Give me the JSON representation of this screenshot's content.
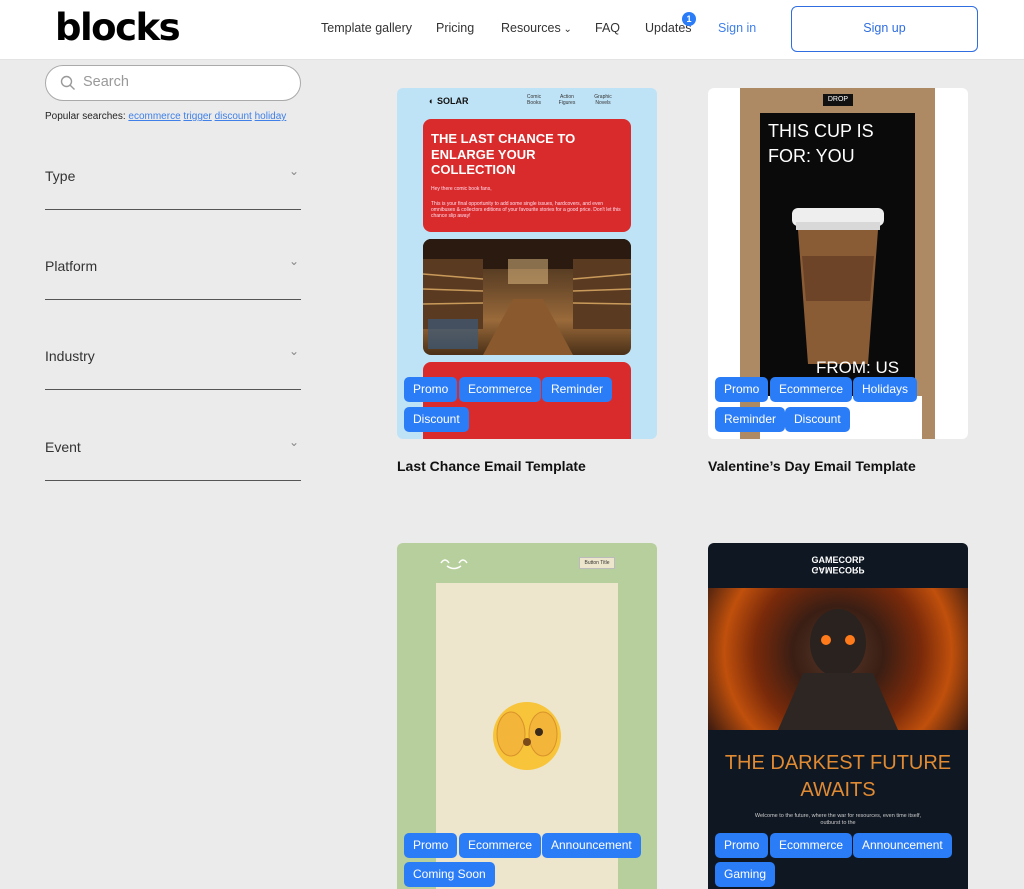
{
  "header": {
    "logo": "blocks",
    "nav": {
      "template_gallery": "Template gallery",
      "pricing": "Pricing",
      "resources": "Resources",
      "faq": "FAQ",
      "updates": "Updates",
      "updates_badge": "1",
      "sign_in": "Sign in",
      "sign_up": "Sign up"
    }
  },
  "sidebar": {
    "search_placeholder": "Search",
    "popular_label": "Popular searches:",
    "popular": [
      "ecommerce",
      "trigger",
      "discount",
      "holiday"
    ],
    "filters": [
      "Type",
      "Platform",
      "Industry",
      "Event"
    ]
  },
  "cards": [
    {
      "title": "Last Chance Email Template",
      "tags": [
        "Promo",
        "Ecommerce",
        "Reminder",
        "Discount"
      ],
      "preview": {
        "brand": "SOLAR",
        "nav": [
          "Comic Books",
          "Action Figures",
          "Graphic Novels"
        ],
        "headline": "THE LAST CHANCE TO ENLARGE YOUR COLLECTION",
        "greeting": "Hey there comic book fans,",
        "body": "This is your final opportunity to add some single issues, hardcovers, and even omnibuses & collectors editions of your favourite stories for a good price. Don't let this chance slip away!"
      }
    },
    {
      "title": "Valentine’s Day Email Template",
      "tags": [
        "Promo",
        "Ecommerce",
        "Holidays",
        "Reminder",
        "Discount"
      ],
      "preview": {
        "label": "DROP",
        "headline": "THIS CUP IS FOR: YOU",
        "footer": "FROM: US"
      }
    },
    {
      "title": "",
      "tags": [
        "Promo",
        "Ecommerce",
        "Announcement",
        "Coming Soon"
      ],
      "preview": {
        "button": "Button Title"
      }
    },
    {
      "title": "",
      "tags": [
        "Promo",
        "Ecommerce",
        "Announcement",
        "Gaming"
      ],
      "preview": {
        "brand": "GAMECORP",
        "headline": "THE DARKEST FUTURE AWAITS",
        "body": "Welcome to the future, where the war for resources, even time itself, outburst to the"
      }
    }
  ],
  "colors": {
    "accent": "#2b7cf7",
    "background": "#ebebeb"
  }
}
